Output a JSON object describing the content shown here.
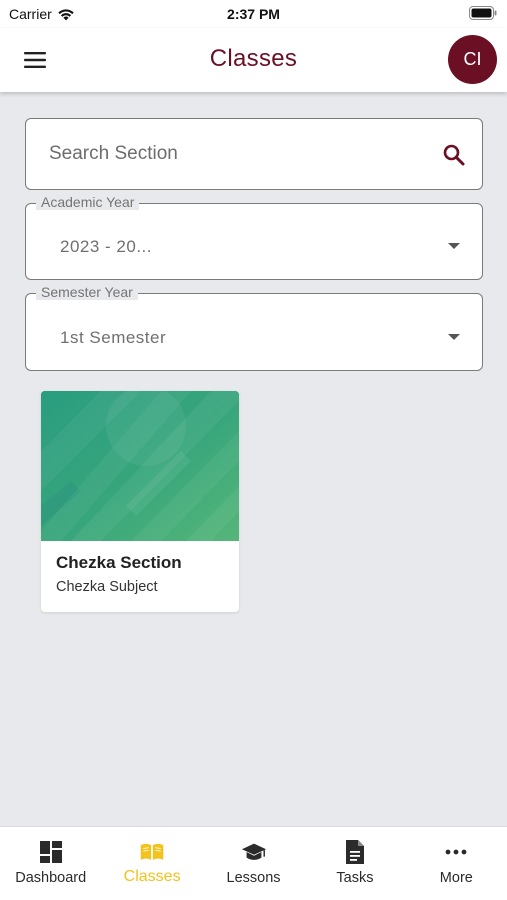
{
  "status_bar": {
    "carrier": "Carrier",
    "time": "2:37 PM"
  },
  "header": {
    "title": "Classes",
    "avatar_initials": "CI",
    "menu_icon": "hamburger-menu-icon"
  },
  "search": {
    "placeholder": "Search Section",
    "value": "",
    "icon": "search-icon"
  },
  "filters": {
    "academic_year": {
      "label": "Academic Year",
      "value": "2023 - 20..."
    },
    "semester": {
      "label": "Semester Year",
      "value": "1st Semester"
    }
  },
  "classes": [
    {
      "section": "Chezka Section",
      "subject": "Chezka Subject"
    }
  ],
  "bottom_nav": {
    "items": [
      {
        "label": "Dashboard",
        "icon": "dashboard-icon",
        "active": false
      },
      {
        "label": "Classes",
        "icon": "book-open-icon",
        "active": true
      },
      {
        "label": "Lessons",
        "icon": "graduation-cap-icon",
        "active": false
      },
      {
        "label": "Tasks",
        "icon": "document-icon",
        "active": false
      },
      {
        "label": "More",
        "icon": "more-dots-icon",
        "active": false
      }
    ]
  },
  "colors": {
    "brand": "#6b0f24",
    "active_nav": "#f2c21d",
    "background": "#e8e9ec",
    "card_banner": "#36a27c"
  }
}
